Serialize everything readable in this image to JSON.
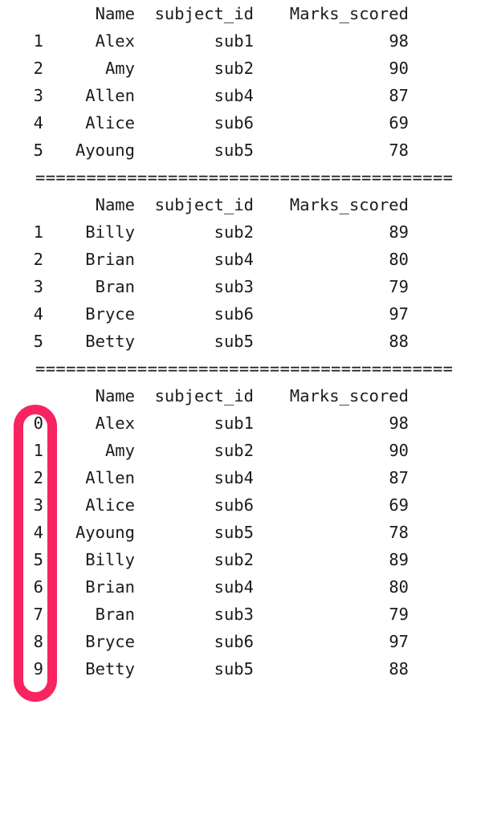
{
  "console_output": {
    "columns": [
      "Name",
      "subject_id",
      "Marks_scored"
    ],
    "header_index_label": "",
    "separator": "=========================================",
    "blocks": [
      {
        "id": "dataframe-one",
        "header": {
          "index": "",
          "name": "Name",
          "subject": "subject_id",
          "marks": "Marks_scored"
        },
        "rows": [
          {
            "index": "1",
            "name": "Alex",
            "subject": "sub1",
            "marks": "98"
          },
          {
            "index": "2",
            "name": "Amy",
            "subject": "sub2",
            "marks": "90"
          },
          {
            "index": "3",
            "name": "Allen",
            "subject": "sub4",
            "marks": "87"
          },
          {
            "index": "4",
            "name": "Alice",
            "subject": "sub6",
            "marks": "69"
          },
          {
            "index": "5",
            "name": "Ayoung",
            "subject": "sub5",
            "marks": "78"
          }
        ]
      },
      {
        "id": "dataframe-two",
        "header": {
          "index": "",
          "name": "Name",
          "subject": "subject_id",
          "marks": "Marks_scored"
        },
        "rows": [
          {
            "index": "1",
            "name": "Billy",
            "subject": "sub2",
            "marks": "89"
          },
          {
            "index": "2",
            "name": "Brian",
            "subject": "sub4",
            "marks": "80"
          },
          {
            "index": "3",
            "name": "Bran",
            "subject": "sub3",
            "marks": "79"
          },
          {
            "index": "4",
            "name": "Bryce",
            "subject": "sub6",
            "marks": "97"
          },
          {
            "index": "5",
            "name": "Betty",
            "subject": "sub5",
            "marks": "88"
          }
        ]
      },
      {
        "id": "dataframe-concatenated",
        "header": {
          "index": "",
          "name": "Name",
          "subject": "subject_id",
          "marks": "Marks_scored"
        },
        "rows": [
          {
            "index": "0",
            "name": "Alex",
            "subject": "sub1",
            "marks": "98"
          },
          {
            "index": "1",
            "name": "Amy",
            "subject": "sub2",
            "marks": "90"
          },
          {
            "index": "2",
            "name": "Allen",
            "subject": "sub4",
            "marks": "87"
          },
          {
            "index": "3",
            "name": "Alice",
            "subject": "sub6",
            "marks": "69"
          },
          {
            "index": "4",
            "name": "Ayoung",
            "subject": "sub5",
            "marks": "78"
          },
          {
            "index": "5",
            "name": "Billy",
            "subject": "sub2",
            "marks": "89"
          },
          {
            "index": "6",
            "name": "Brian",
            "subject": "sub4",
            "marks": "80"
          },
          {
            "index": "7",
            "name": "Bran",
            "subject": "sub3",
            "marks": "79"
          },
          {
            "index": "8",
            "name": "Bryce",
            "subject": "sub6",
            "marks": "97"
          },
          {
            "index": "9",
            "name": "Betty",
            "subject": "sub5",
            "marks": "88"
          }
        ]
      }
    ]
  },
  "annotation": {
    "shape": "rounded-rectangle-outline",
    "color": "#f7245f",
    "target": "index-column-of-concatenated-dataframe"
  }
}
